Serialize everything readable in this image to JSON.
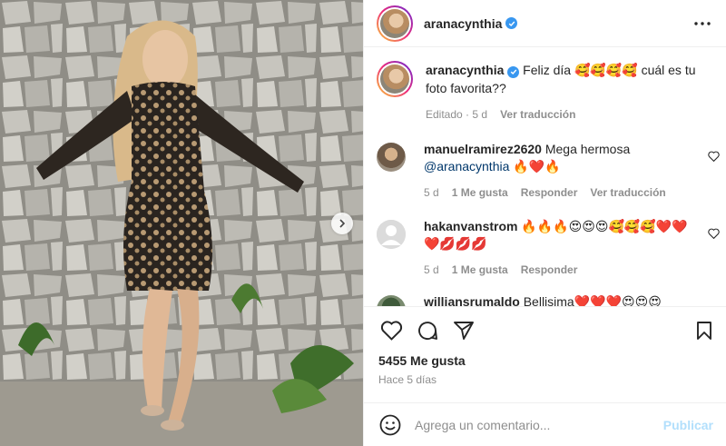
{
  "post": {
    "username": "aranacynthia",
    "verified": true
  },
  "caption": {
    "username": "aranacynthia",
    "text": "Feliz día 🥰🥰🥰🥰 cuál es tu foto favorita??",
    "edited": "Editado",
    "age": "5 d",
    "translate": "Ver traducción"
  },
  "comments": [
    {
      "username": "manuelramirez2620",
      "text": "Mega hermosa",
      "mention": "@aranacynthia",
      "text_after": "🔥❤️🔥",
      "age": "5 d",
      "likes": "1 Me gusta",
      "reply": "Responder",
      "translate": "Ver traducción"
    },
    {
      "username": "hakanvanstrom",
      "text": "🔥🔥🔥😍😍😍🥰🥰🥰❤️❤️❤️💋💋💋",
      "age": "5 d",
      "likes": "1 Me gusta",
      "reply": "Responder"
    },
    {
      "username": "williansrumaldo",
      "text": "Bellisima❤️❤️❤️😍😍😍"
    }
  ],
  "stats": {
    "likes": "5455 Me gusta",
    "date": "Hace 5 días"
  },
  "composer": {
    "placeholder": "Agrega un comentario...",
    "publish": "Publicar"
  },
  "icons": {
    "verified": "verified-badge-icon",
    "more": "more-options-icon",
    "heart": "heart-icon",
    "comment": "comment-icon",
    "share": "share-icon",
    "save": "bookmark-icon",
    "emoji": "emoji-icon",
    "next": "chevron-right-icon"
  },
  "colors": {
    "verified": "#3897f0",
    "mention": "#00376b",
    "publish": "#b2dffc",
    "muted": "#8e8e8e"
  }
}
